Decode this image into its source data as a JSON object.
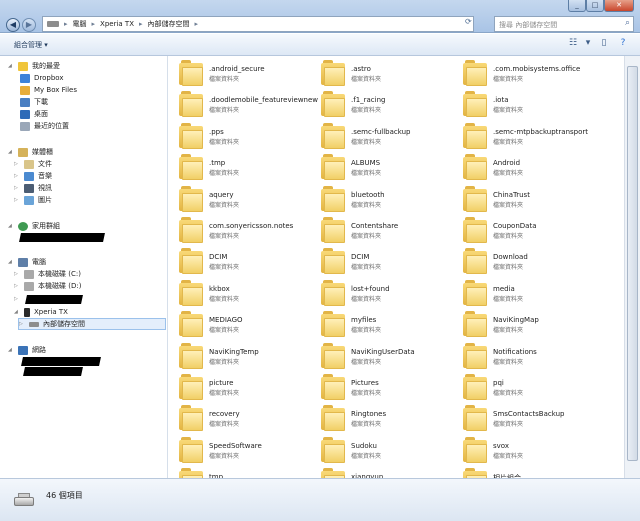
{
  "window": {
    "address": {
      "segments": [
        "電腦",
        "Xperia TX",
        "內部儲存空間"
      ]
    },
    "search": {
      "placeholder": "搜尋 內部儲存空間"
    }
  },
  "toolbar": {
    "organize_label": "組合管理 ▾"
  },
  "sidebar": {
    "favorites_header": "我的最愛",
    "favorites": [
      "Dropbox",
      "My Box Files",
      "下載",
      "桌面",
      "最近的位置"
    ],
    "libraries_header": "媒體櫃",
    "libraries": [
      "文件",
      "音樂",
      "視訊",
      "圖片"
    ],
    "homegroup_header": "家用群組",
    "computer_header": "電腦",
    "drives": [
      "本機磁碟 (C:)",
      "本機磁碟 (D:)"
    ],
    "device": "Xperia TX",
    "device_storage": "內部儲存空間",
    "network_header": "網路"
  },
  "files": {
    "type_label": "檔案資料夾",
    "items": [
      ".android_secure",
      ".astro",
      ".com.mobisystems.office",
      ".doodlemobile_featureviewnew",
      ".f1_racing",
      ".iota",
      ".pps",
      ".semc-fullbackup",
      ".semc-mtpbackuptransport",
      ".tmp",
      "ALBUMS",
      "Android",
      "aquery",
      "bluetooth",
      "ChinaTrust",
      "com.sonyericsson.notes",
      "Contentshare",
      "CouponData",
      "DCIM",
      "DCIM",
      "Download",
      "kkbox",
      "lost+found",
      "media",
      "MEDIAGO",
      "myfiles",
      "NaviKingMap",
      "NaviKingTemp",
      "NaviKingUserData",
      "Notifications",
      "picture",
      "Pictures",
      "pqi",
      "recovery",
      "Ringtones",
      "SmsContactsBackup",
      "SpeedSoftware",
      "Sudoku",
      "svox",
      "tmp",
      "xiangyun",
      "相片組合"
    ]
  },
  "status": {
    "item_count": "46 個項目"
  },
  "colors": {
    "folder": "#f1cf66",
    "selection": "#e4eefb",
    "titlebar": "#a9c4e6"
  }
}
